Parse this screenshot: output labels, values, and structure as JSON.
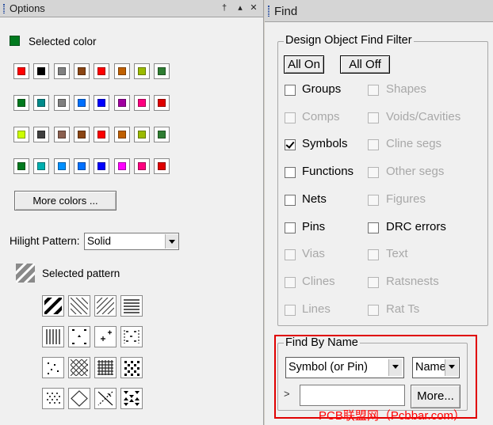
{
  "options": {
    "title": "Options",
    "pin_glyph": "†",
    "up_glyph": "▴",
    "close_glyph": "✕",
    "selected_color_label": "Selected color",
    "selected_color": "#007a1e",
    "swatch_rows": [
      [
        "#ff0000",
        "#000000",
        "#808080",
        "#8b4513",
        "#ff0000",
        "#c06000",
        "#9bbb00",
        "#2e7d32"
      ],
      [
        "#007a1e",
        "#008b8b",
        "#808080",
        "#0070ff",
        "#0000ff",
        "#a000a0",
        "#ff0080",
        "#e00000"
      ],
      [
        "#ccff00",
        "#404040",
        "#8b6050",
        "#8b4513",
        "#ff0000",
        "#c06000",
        "#9bbb00",
        "#2e7d32"
      ],
      [
        "#007a1e",
        "#00b0b0",
        "#0090ff",
        "#0070ff",
        "#0000ff",
        "#ff00ff",
        "#ff0080",
        "#e00000"
      ]
    ],
    "more_colors_label": "More colors ...",
    "hilight_label": "Hilight Pattern:",
    "hilight_value": "Solid",
    "selected_pattern_label": "Selected pattern"
  },
  "find": {
    "title": "Find",
    "filter_title": "Design Object Find Filter",
    "all_on_label": "All On",
    "all_off_label": "All Off",
    "left_items": [
      {
        "label": "Groups",
        "enabled": true,
        "checked": false
      },
      {
        "label": "Comps",
        "enabled": false,
        "checked": false
      },
      {
        "label": "Symbols",
        "enabled": true,
        "checked": true
      },
      {
        "label": "Functions",
        "enabled": true,
        "checked": false
      },
      {
        "label": "Nets",
        "enabled": true,
        "checked": false
      },
      {
        "label": "Pins",
        "enabled": true,
        "checked": false
      },
      {
        "label": "Vias",
        "enabled": false,
        "checked": false
      },
      {
        "label": "Clines",
        "enabled": false,
        "checked": false
      },
      {
        "label": "Lines",
        "enabled": false,
        "checked": false
      }
    ],
    "right_items": [
      {
        "label": "Shapes",
        "enabled": false,
        "checked": false
      },
      {
        "label": "Voids/Cavities",
        "enabled": false,
        "checked": false
      },
      {
        "label": "Cline segs",
        "enabled": false,
        "checked": false
      },
      {
        "label": "Other segs",
        "enabled": false,
        "checked": false
      },
      {
        "label": "Figures",
        "enabled": false,
        "checked": false
      },
      {
        "label": "DRC errors",
        "enabled": true,
        "checked": false
      },
      {
        "label": "Text",
        "enabled": false,
        "checked": false
      },
      {
        "label": "Ratsnests",
        "enabled": false,
        "checked": false
      },
      {
        "label": "Rat Ts",
        "enabled": false,
        "checked": false
      }
    ],
    "by_name_title": "Find By Name",
    "object_type_value": "Symbol (or Pin)",
    "name_mode_value": "Name",
    "name_prompt": ">",
    "name_value": "",
    "more_label": "More...",
    "highlight_color": "#e00000"
  },
  "watermark": "PCB联盟网（Pcbbar.com）"
}
